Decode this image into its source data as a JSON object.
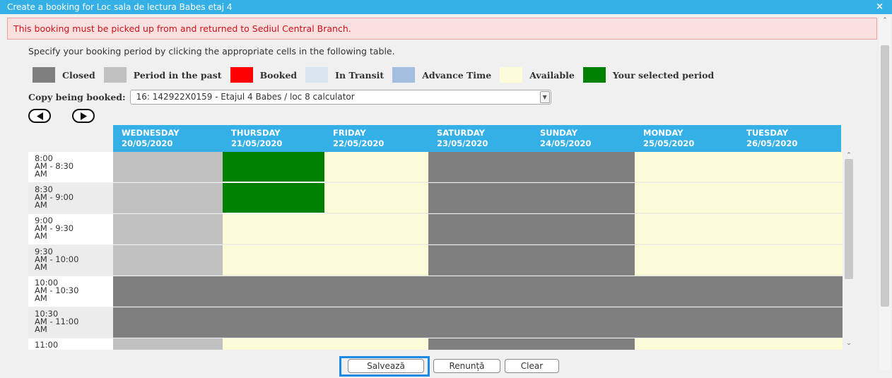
{
  "dialog": {
    "title": "Create a booking for Loc sala de lectura Babes etaj 4",
    "close_label": "×"
  },
  "alert": {
    "text": "This booking must be picked up from and returned to Sediul Central Branch."
  },
  "instruction": "Specify your booking period by clicking the appropriate cells in the following table.",
  "legend": [
    {
      "label": "Closed",
      "color": "#7f7f7f"
    },
    {
      "label": "Period in the past",
      "color": "#c0c0c0"
    },
    {
      "label": "Booked",
      "color": "#ff0000"
    },
    {
      "label": "In Transit",
      "color": "#dbe5f1"
    },
    {
      "label": "Advance Time",
      "color": "#a3bddf"
    },
    {
      "label": "Available",
      "color": "#fdfcd9"
    },
    {
      "label": "Your selected period",
      "color": "#008000"
    }
  ],
  "copy": {
    "label": "Copy being booked:",
    "value": "16: 142922X0159 - Etajul 4 Babes / loc 8 calculator"
  },
  "days": [
    {
      "day": "WEDNESDAY",
      "date": "20/05/2020"
    },
    {
      "day": "THURSDAY",
      "date": "21/05/2020"
    },
    {
      "day": "FRIDAY",
      "date": "22/05/2020"
    },
    {
      "day": "SATURDAY",
      "date": "23/05/2020"
    },
    {
      "day": "SUNDAY",
      "date": "24/05/2020"
    },
    {
      "day": "MONDAY",
      "date": "25/05/2020"
    },
    {
      "day": "TUESDAY",
      "date": "26/05/2020"
    }
  ],
  "slots": [
    {
      "time": "8:00\nAM - 8:30\nAM",
      "cells": [
        "past",
        "selected",
        "available",
        "closed",
        "closed",
        "available",
        "available"
      ]
    },
    {
      "time": "8:30\nAM - 9:00\nAM",
      "cells": [
        "past",
        "selected",
        "available",
        "closed",
        "closed",
        "available",
        "available"
      ]
    },
    {
      "time": "9:00\nAM - 9:30\nAM",
      "cells": [
        "past",
        "available",
        "available",
        "closed",
        "closed",
        "available",
        "available"
      ]
    },
    {
      "time": "9:30\nAM - 10:00\nAM",
      "cells": [
        "past",
        "available",
        "available",
        "closed",
        "closed",
        "available",
        "available"
      ]
    },
    {
      "time": "10:00\nAM - 10:30\nAM",
      "cells": [
        "closed",
        "closed",
        "closed",
        "closed",
        "closed",
        "closed",
        "closed"
      ]
    },
    {
      "time": "10:30\nAM - 11:00\nAM",
      "cells": [
        "closed",
        "closed",
        "closed",
        "closed",
        "closed",
        "closed",
        "closed"
      ]
    },
    {
      "time": "11:00",
      "cells": [
        "past",
        "available",
        "available",
        "closed",
        "closed",
        "available",
        "available"
      ]
    }
  ],
  "status_colors": {
    "closed": "#7f7f7f",
    "past": "#c0c0c0",
    "booked": "#ff0000",
    "available": "#fdfcd9",
    "selected": "#008000"
  },
  "buttons": {
    "save": "Salvează",
    "cancel": "Renunță",
    "clear": "Clear"
  }
}
